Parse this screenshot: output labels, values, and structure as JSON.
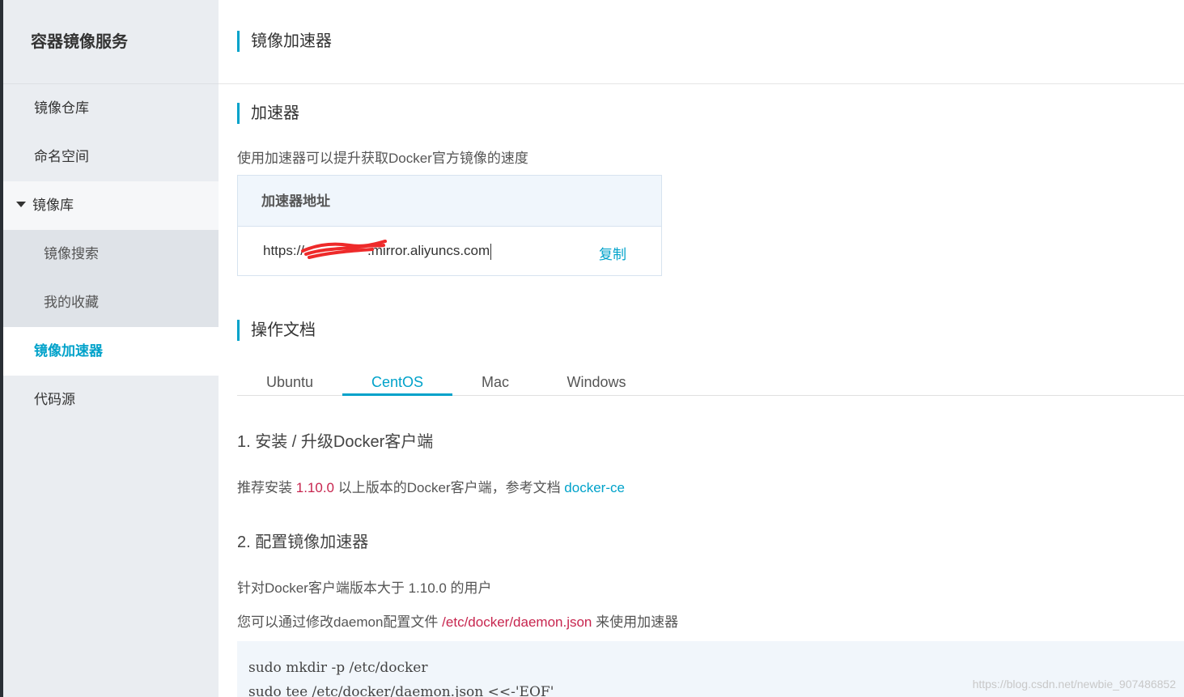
{
  "sidebar": {
    "title": "容器镜像服务",
    "items": [
      {
        "label": "镜像仓库"
      },
      {
        "label": "命名空间"
      },
      {
        "label": "镜像库"
      },
      {
        "label": "镜像搜索"
      },
      {
        "label": "我的收藏"
      },
      {
        "label": "镜像加速器"
      },
      {
        "label": "代码源"
      }
    ]
  },
  "main": {
    "page_title": "镜像加速器",
    "accelerator": {
      "section_title": "加速器",
      "description": "使用加速器可以提升获取Docker官方镜像的速度",
      "box_header": "加速器地址",
      "url_prefix": "https://",
      "url_suffix": ".mirror.aliyuncs.com",
      "copy_label": "复制"
    },
    "docs": {
      "section_title": "操作文档",
      "tabs": [
        "Ubuntu",
        "CentOS",
        "Mac",
        "Windows"
      ],
      "active_tab": "CentOS",
      "step1_title": "1. 安装 / 升级Docker客户端",
      "step1_text_a": "推荐安装 ",
      "step1_version": "1.10.0",
      "step1_text_b": " 以上版本的Docker客户端，参考文档 ",
      "step1_link": "docker-ce",
      "step2_title": "2. 配置镜像加速器",
      "step2_text1": "针对Docker客户端版本大于 1.10.0 的用户",
      "step2_text2_a": "您可以通过修改daemon配置文件 ",
      "step2_path": "/etc/docker/daemon.json",
      "step2_text2_b": " 来使用加速器",
      "code_lines": [
        "sudo mkdir -p /etc/docker",
        "sudo tee /etc/docker/daemon.json <<-'EOF'"
      ]
    }
  },
  "watermark": "https://blog.csdn.net/newbie_907486852",
  "colors": {
    "accent": "#00a2ca",
    "highlight": "#c7254e",
    "sidebar_bg": "#eaedf1"
  }
}
